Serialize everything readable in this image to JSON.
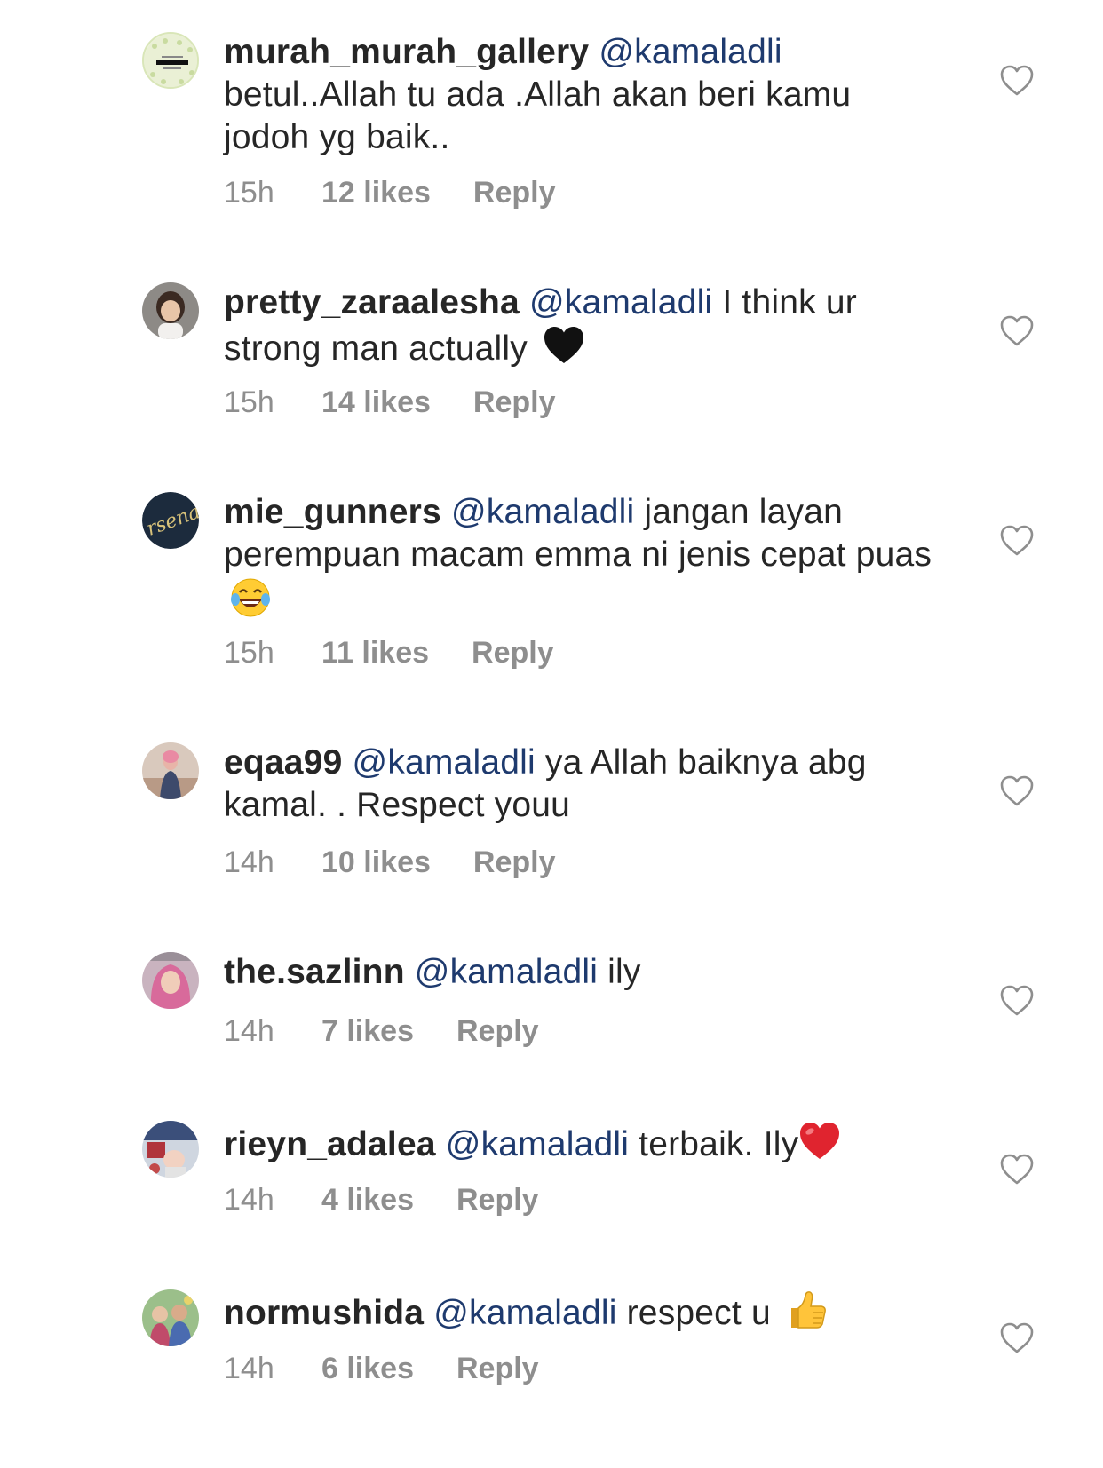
{
  "comments": [
    {
      "username": "murah_murah_gallery",
      "mention": "@kamaladli",
      "text": "betul..Allah tu ada .Allah akan beri kamu jodoh yg baik..",
      "emoji": "",
      "time": "15h",
      "likes": "12 likes",
      "reply": "Reply"
    },
    {
      "username": "pretty_zaraalesha",
      "mention": "@kamaladli",
      "text": "I think ur strong man actually",
      "emoji": "black-heart-emoji",
      "time": "15h",
      "likes": "14 likes",
      "reply": "Reply"
    },
    {
      "username": "mie_gunners",
      "mention": "@kamaladli",
      "text": " jangan layan perempuan macam emma ni jenis cepat puas",
      "emoji": "tears-of-joy-emoji",
      "time": "15h",
      "likes": "11 likes",
      "reply": "Reply"
    },
    {
      "username": "eqaa99",
      "mention": "@kamaladli",
      "text": "ya Allah baiknya abg kamal. . Respect youu",
      "emoji": "",
      "time": "14h",
      "likes": "10 likes",
      "reply": "Reply"
    },
    {
      "username": "the.sazlinn",
      "mention": "@kamaladli",
      "text": "ily",
      "emoji": "",
      "time": "14h",
      "likes": "7 likes",
      "reply": "Reply"
    },
    {
      "username": "rieyn_adalea",
      "mention": "@kamaladli",
      "text": "terbaik.  Ily",
      "emoji": "red-heart-emoji",
      "time": "14h",
      "likes": "4 likes",
      "reply": "Reply"
    },
    {
      "username": "normushida",
      "mention": "@kamaladli",
      "text": "respect u",
      "emoji": "thumbs-up-emoji",
      "time": "14h",
      "likes": "6 likes",
      "reply": "Reply"
    }
  ],
  "icons": {
    "like": "heart-outline-icon"
  },
  "colors": {
    "username": "#262626",
    "mention": "#1e3a6e",
    "meta": "#8e8e8e",
    "heart_outline": "#8e8e8e"
  }
}
